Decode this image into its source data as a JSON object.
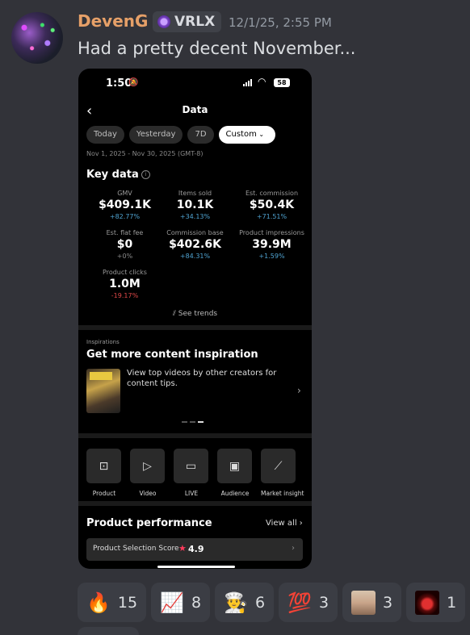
{
  "message": {
    "username": "DevenG",
    "tag": "VRLX",
    "timestamp": "12/1/25, 2:55 PM",
    "text": "Had a pretty decent November..."
  },
  "phone": {
    "status_time": "1:50",
    "battery": "58",
    "title": "Data",
    "back_icon": "chevron-left-icon",
    "filters": [
      "Today",
      "Yesterday",
      "7D",
      "Custom"
    ],
    "selected_filter": "Custom",
    "date_range": "Nov 1, 2025 - Nov 30, 2025 (GMT-8)",
    "key_data_title": "Key data",
    "metrics": [
      {
        "label": "GMV",
        "value": "$409.1K",
        "change": "+82.77%",
        "trend": "up"
      },
      {
        "label": "Items sold",
        "value": "10.1K",
        "change": "+34.13%",
        "trend": "up"
      },
      {
        "label": "Est. commission",
        "value": "$50.4K",
        "change": "+71.51%",
        "trend": "up"
      },
      {
        "label": "Est. flat fee",
        "value": "$0",
        "change": "+0%",
        "trend": "neutral"
      },
      {
        "label": "Commission base",
        "value": "$402.6K",
        "change": "+84.31%",
        "trend": "up"
      },
      {
        "label": "Product impressions",
        "value": "39.9M",
        "change": "+1.59%",
        "trend": "up"
      },
      {
        "label": "Product clicks",
        "value": "1.0M",
        "change": "-19.17%",
        "trend": "down"
      }
    ],
    "see_trends": "See trends",
    "inspiration": {
      "label": "Inspirations",
      "title": "Get more content inspiration",
      "description": "View top videos by other creators for content tips."
    },
    "tools": [
      {
        "label": "Product",
        "icon": "bag-icon"
      },
      {
        "label": "Video",
        "icon": "play-icon"
      },
      {
        "label": "LIVE",
        "icon": "live-tv-icon"
      },
      {
        "label": "Audience",
        "icon": "id-card-icon"
      },
      {
        "label": "Market insight",
        "icon": "chart-line-icon"
      }
    ],
    "product_performance": {
      "title": "Product performance",
      "view_all": "View all",
      "score_label": "Product Selection Score",
      "score": "4.9"
    }
  },
  "reactions": [
    {
      "emoji": "🔥",
      "name": "fire-emoji",
      "count": "15"
    },
    {
      "emoji": "📈",
      "name": "chart-increasing-emoji",
      "count": "8"
    },
    {
      "emoji": "👨‍🍳",
      "name": "chef-emoji",
      "count": "6"
    },
    {
      "emoji": "💯",
      "name": "hundred-points-emoji",
      "count": "3"
    },
    {
      "emoji": "",
      "name": "custom-face-emoji",
      "count": "3"
    },
    {
      "emoji": "",
      "name": "custom-red-eye-emoji",
      "count": "1"
    }
  ],
  "colors": {
    "username": "#e6a068",
    "positive_change": "#4fa3d1",
    "negative_change": "#e04848",
    "neutral_change": "#8a8a8a",
    "star": "#ff3b5c"
  }
}
